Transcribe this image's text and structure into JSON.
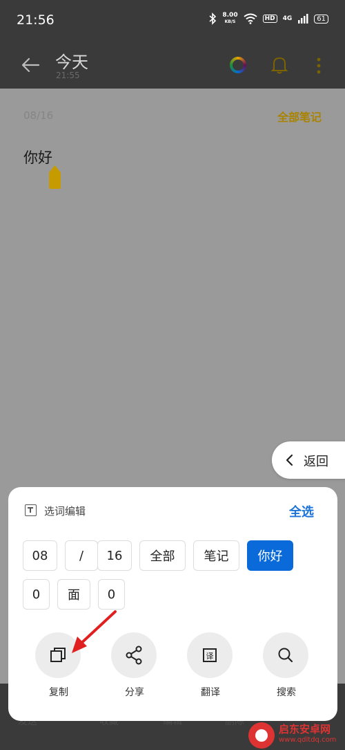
{
  "status_bar": {
    "time": "21:56",
    "speed_value": "8.00",
    "speed_unit": "KB/S",
    "hd": "HD",
    "network": "4G",
    "battery": "61"
  },
  "app_bar": {
    "title": "今天",
    "subtitle": "21:55"
  },
  "note": {
    "date": "08/16",
    "all_notes_link": "全部笔记",
    "content": "你好"
  },
  "back_pill": {
    "label": "返回"
  },
  "panel": {
    "title": "选词编辑",
    "select_all": "全选",
    "chips_row1": [
      "08",
      "/",
      "16",
      "全部",
      "笔记",
      "你好"
    ],
    "chips_row2": [
      "0",
      "面",
      "0"
    ],
    "actions": [
      {
        "label": "复制",
        "icon": "copy-icon"
      },
      {
        "label": "分享",
        "icon": "share-icon"
      },
      {
        "label": "翻译",
        "icon": "translate-icon"
      },
      {
        "label": "搜索",
        "icon": "search-icon"
      }
    ]
  },
  "bottom_bar": {
    "items": [
      "发送",
      "收藏",
      "编辑",
      "删除"
    ]
  },
  "watermark": {
    "name": "启东安卓网",
    "url": "www.qdltdq.com"
  },
  "colors": {
    "accent_gold": "#a98300",
    "accent_blue": "#0a6ad9",
    "annotation_red": "#e02020"
  }
}
